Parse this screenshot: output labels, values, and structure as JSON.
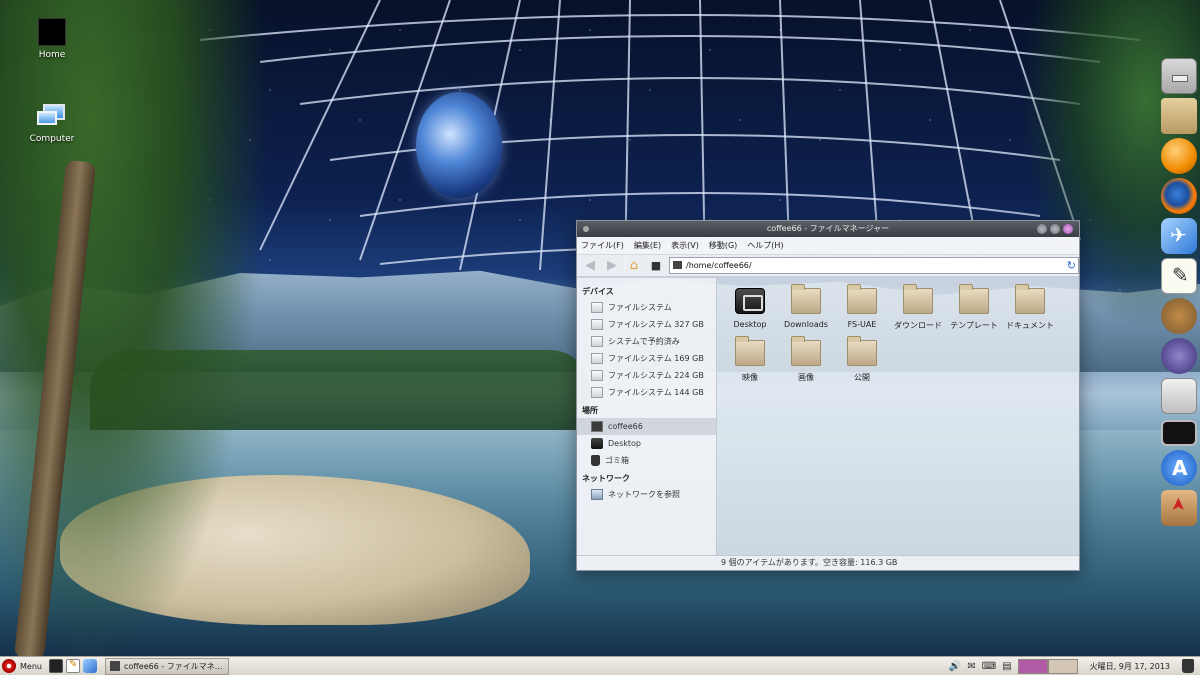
{
  "desktop": {
    "icons": [
      {
        "label": "Home",
        "icon": "home-folder-icon"
      },
      {
        "label": "Computer",
        "icon": "computer-icon"
      }
    ],
    "dock": [
      "drawer-icon",
      "folder-icon",
      "orange-app-icon",
      "firefox-icon",
      "safari-icon",
      "text-editor-icon",
      "gimp-icon",
      "pen-app-icon",
      "window-manager-icon",
      "monitor-icon",
      "app-store-icon",
      "package-installer-icon"
    ]
  },
  "window": {
    "title": "coffee66 - ファイルマネージャー",
    "menu": [
      "ファイル(F)",
      "編集(E)",
      "表示(V)",
      "移動(G)",
      "ヘルプ(H)"
    ],
    "address": "/home/coffee66/",
    "sidebar": {
      "devices_header": "デバイス",
      "devices": [
        "ファイルシステム",
        "ファイルシステム 327 GB",
        "システムで予約済み",
        "ファイルシステム 169 GB",
        "ファイルシステム 224 GB",
        "ファイルシステム 144 GB"
      ],
      "places_header": "場所",
      "places": [
        {
          "label": "coffee66",
          "icon": "computer-icon",
          "selected": true
        },
        {
          "label": "Desktop",
          "icon": "desktop-icon",
          "selected": false
        },
        {
          "label": "ゴミ箱",
          "icon": "trash-icon",
          "selected": false
        }
      ],
      "network_header": "ネットワーク",
      "network": [
        "ネットワークを参照"
      ]
    },
    "files": [
      {
        "name": "Desktop",
        "icon": "desktop-icon"
      },
      {
        "name": "Downloads",
        "icon": "folder-icon"
      },
      {
        "name": "FS-UAE",
        "icon": "folder-icon"
      },
      {
        "name": "ダウンロード",
        "icon": "folder-icon"
      },
      {
        "name": "テンプレート",
        "icon": "folder-icon"
      },
      {
        "name": "ドキュメント",
        "icon": "folder-icon"
      },
      {
        "name": "映像",
        "icon": "folder-icon"
      },
      {
        "name": "画像",
        "icon": "folder-icon"
      },
      {
        "name": "公開",
        "icon": "folder-icon"
      }
    ],
    "status": "9 個のアイテムがあります。空き容量: 116.3 GB"
  },
  "taskbar": {
    "menu_label": "Menu",
    "task_label": "coffee66 - ファイルマネ...",
    "clock": "火曜日, 9月 17, 2013"
  }
}
